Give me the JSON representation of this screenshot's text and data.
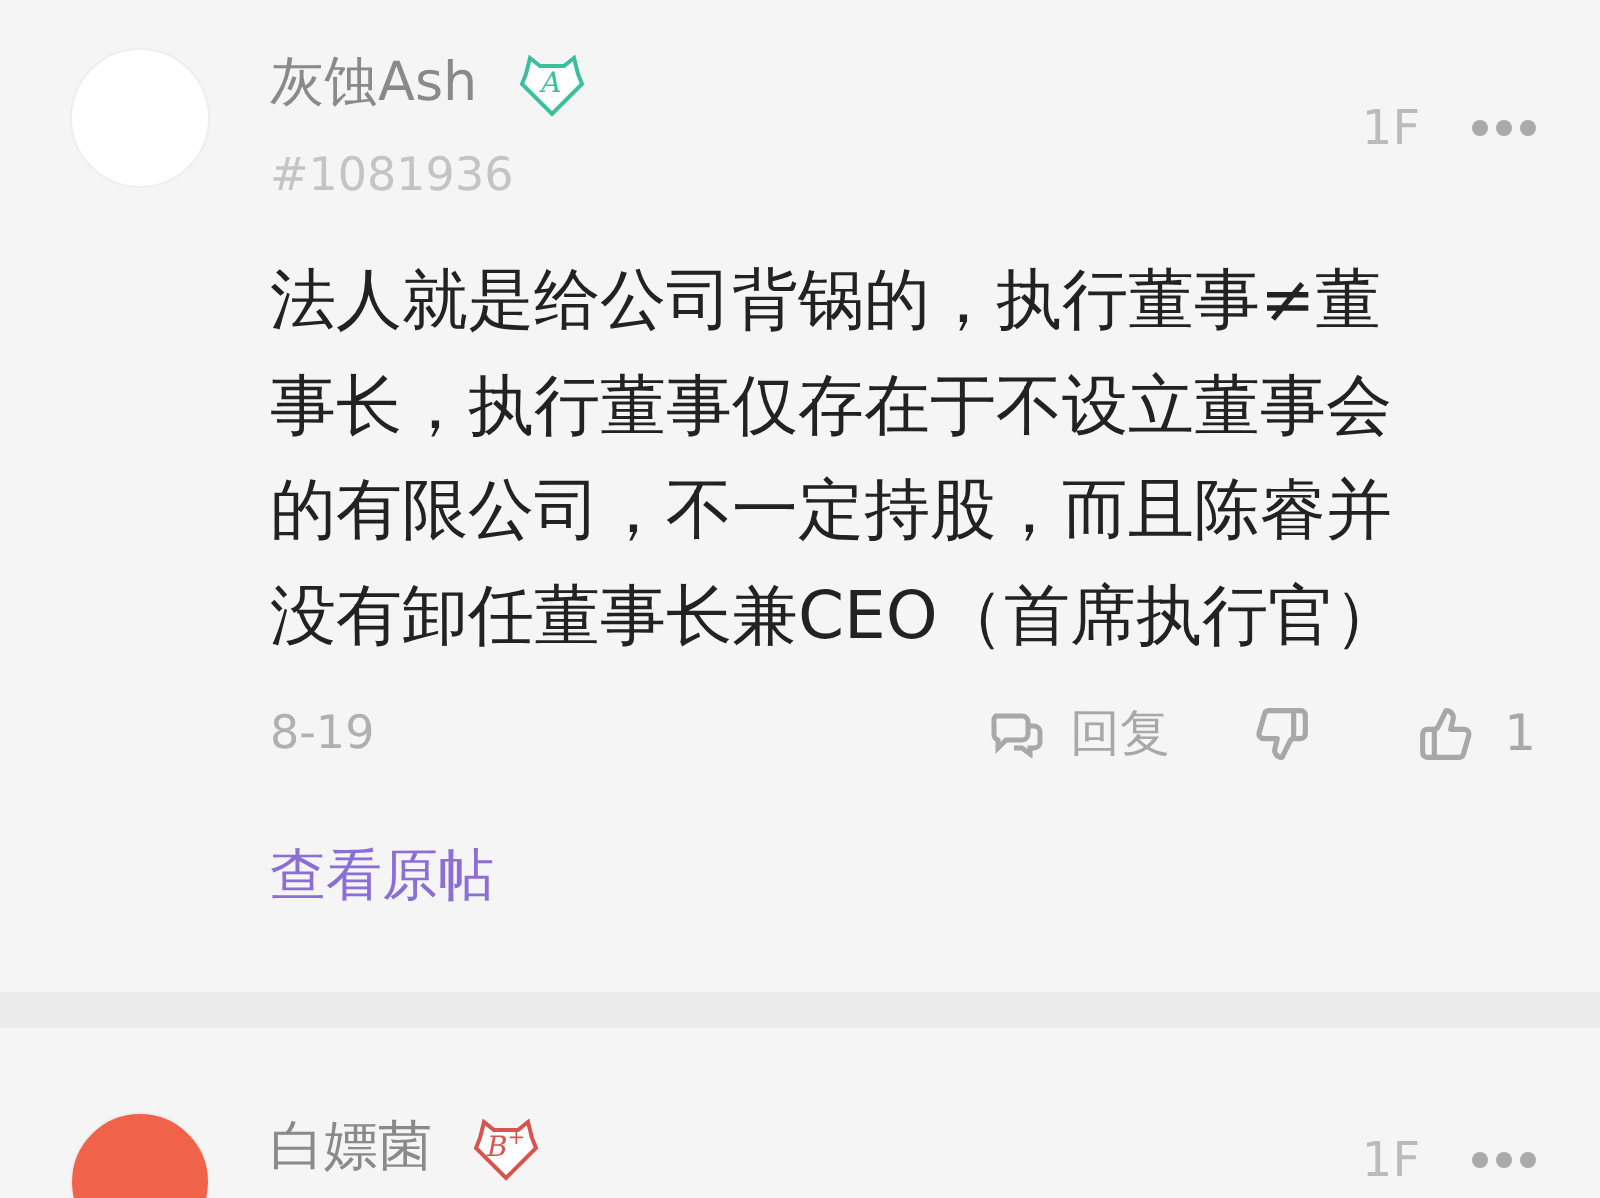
{
  "comments": [
    {
      "user": "灰蚀Ash",
      "badge": {
        "text": "A",
        "color": "#3dbf9e"
      },
      "avatar": {
        "color": "#ffffff"
      },
      "user_id": "#1081936",
      "floor": "1F",
      "content": "法人就是给公司背锅的，执行董事≠董事长，执行董事仅存在于不设立董事会的有限公司，不一定持股，而且陈睿并没有卸任董事长兼CEO（首席执行官）",
      "date": "8-19",
      "reply_label": "回复",
      "likes": "1",
      "view_original": "查看原帖"
    },
    {
      "user": "白嫖菌",
      "badge": {
        "text": "B$^{+}$",
        "color": "#d9534f"
      },
      "avatar": {
        "color": "#f0634a"
      },
      "floor": "1F"
    }
  ]
}
